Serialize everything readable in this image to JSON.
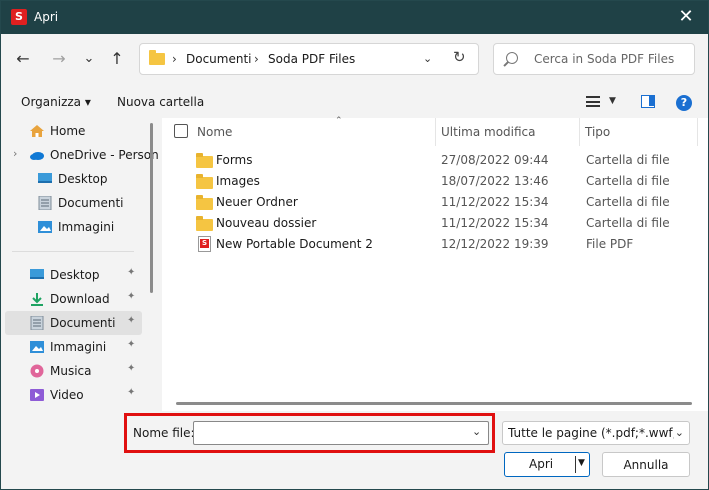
{
  "window": {
    "title": "Apri",
    "app_icon_letter": "S",
    "close_glyph": "✕"
  },
  "nav": {
    "back_glyph": "←",
    "forward_glyph": "→",
    "recent_glyph": "⌄",
    "up_glyph": "↑",
    "breadcrumb": [
      "Documenti",
      "Soda PDF Files"
    ],
    "crumb_sep": "›",
    "dropdown_glyph": "⌄",
    "refresh_glyph": "↻",
    "search_placeholder": "Cerca in Soda PDF Files"
  },
  "toolbar": {
    "organize_label": "Organizza ▾",
    "new_folder_label": "Nuova cartella",
    "help_glyph": "?"
  },
  "sidebar": {
    "top_items": [
      {
        "label": "Home",
        "icon": "home-icon"
      },
      {
        "label": "OneDrive - Person",
        "icon": "onedrive-cloud-icon"
      },
      {
        "label": "Desktop",
        "icon": "desktop-icon"
      },
      {
        "label": "Documenti",
        "icon": "documents-icon"
      },
      {
        "label": "Immagini",
        "icon": "pictures-icon"
      }
    ],
    "pinned_items": [
      {
        "label": "Desktop",
        "icon": "desktop-icon"
      },
      {
        "label": "Download",
        "icon": "download-icon"
      },
      {
        "label": "Documenti",
        "icon": "documents-icon",
        "selected": true
      },
      {
        "label": "Immagini",
        "icon": "pictures-icon"
      },
      {
        "label": "Musica",
        "icon": "music-icon"
      },
      {
        "label": "Video",
        "icon": "video-icon"
      }
    ],
    "chevron_glyph": "›",
    "pin_glyph": "📌"
  },
  "columns": {
    "name": "Nome",
    "modified": "Ultima modifica",
    "type": "Tipo",
    "sort_glyph": "⌃"
  },
  "files": [
    {
      "name": "Forms",
      "date": "27/08/2022 09:44",
      "type": "Cartella di file",
      "icon": "folder-icon"
    },
    {
      "name": "Images",
      "date": "18/07/2022 13:46",
      "type": "Cartella di file",
      "icon": "folder-icon"
    },
    {
      "name": "Neuer Ordner",
      "date": "11/12/2022 15:34",
      "type": "Cartella di file",
      "icon": "folder-icon"
    },
    {
      "name": "Nouveau dossier",
      "date": "11/12/2022 15:34",
      "type": "Cartella di file",
      "icon": "folder-icon"
    },
    {
      "name": "New Portable Document 2",
      "date": "12/12/2022 19:39",
      "type": "File PDF",
      "icon": "pdf-file-icon"
    }
  ],
  "footer": {
    "filename_label": "Nome file:",
    "filename_value": "",
    "filename_dropdown_glyph": "⌄",
    "filter_value": "Tutte le pagine (*.pdf;*.wwf;*.doc",
    "filter_caret_glyph": "⌄",
    "open_label": "Apri",
    "open_caret_glyph": "▼",
    "cancel_label": "Annulla"
  },
  "colors": {
    "titlebar": "#1f4146",
    "accent": "#0067c0",
    "highlight": "#e01010",
    "folder": "#f5c542"
  }
}
